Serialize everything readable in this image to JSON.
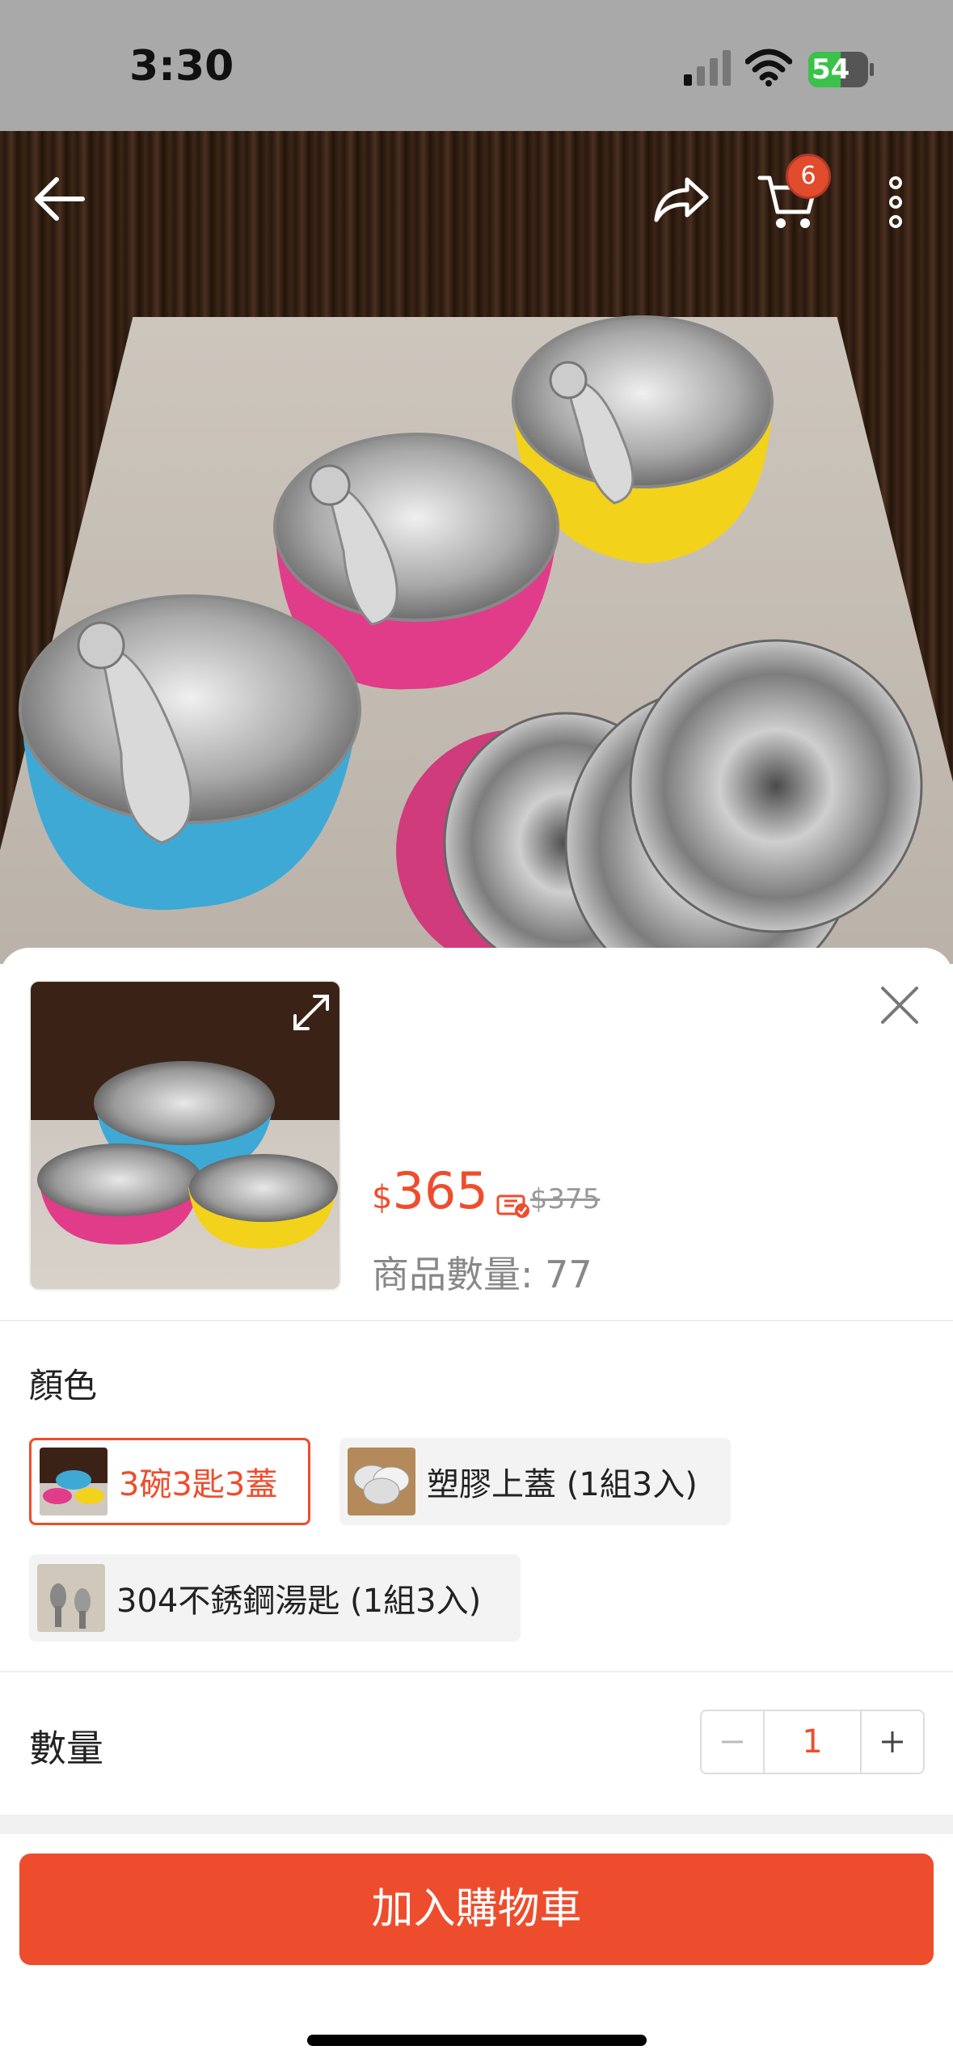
{
  "status_bar": {
    "time": "3:30",
    "battery_level": "54",
    "battery_fraction": 0.54
  },
  "top_nav": {
    "cart_badge": "6",
    "icons": [
      "back-arrow-icon",
      "share-icon",
      "cart-icon",
      "more-vertical-icon"
    ]
  },
  "product": {
    "currency": "$",
    "price": "365",
    "original_price": "$375",
    "stock_label": "商品數量: 77"
  },
  "variation": {
    "label": "顏色",
    "options": [
      {
        "label": "3碗3匙3蓋",
        "selected": true
      },
      {
        "label": "塑膠上蓋 (1組3入)",
        "selected": false
      },
      {
        "label": "304不銹鋼湯匙 (1組3入)",
        "selected": false
      }
    ]
  },
  "quantity": {
    "label": "數量",
    "value": "1"
  },
  "cta": {
    "add_to_cart": "加入購物車"
  },
  "colors": {
    "accent": "#ee4d2d",
    "bowl_blue": "#3fa9d6",
    "bowl_pink": "#e03c8a",
    "bowl_yellow": "#f2d21b"
  }
}
